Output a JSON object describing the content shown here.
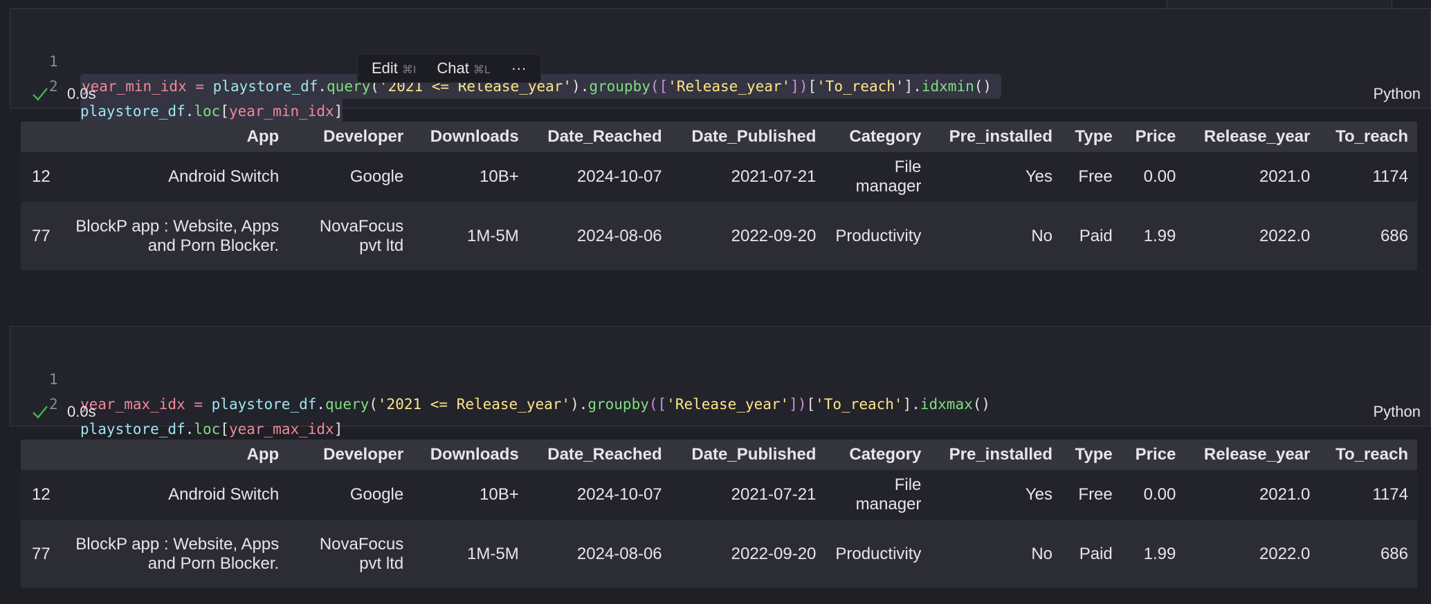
{
  "cells": [
    {
      "code": {
        "line_numbers": [
          "1",
          "2"
        ],
        "l1": {
          "var": "year_min_idx",
          "eq": " = ",
          "obj": "playstore_df",
          "dot": ".",
          "fn1": "query",
          "p1": "(",
          "s1": "'2021 <= Release_year'",
          "p2": ").",
          "fn2": "groupby",
          "b1": "([",
          "s2": "'Release_year'",
          "b2": "])",
          "p3": "[",
          "s3": "'To_reach'",
          "p4": "].",
          "fn3": "idxmin",
          "p5": "()"
        },
        "l2": {
          "obj": "playstore_df",
          "dot": ".",
          "fn": "loc",
          "o": "[",
          "var": "year_min_idx",
          "c": "]"
        }
      },
      "status": {
        "time": "0.0s",
        "language": "Python"
      }
    },
    {
      "code": {
        "line_numbers": [
          "1",
          "2"
        ],
        "l1": {
          "var": "year_max_idx",
          "eq": " = ",
          "obj": "playstore_df",
          "dot": ".",
          "fn1": "query",
          "p1": "(",
          "s1": "'2021 <= Release_year'",
          "p2": ").",
          "fn2": "groupby",
          "b1": "([",
          "s2": "'Release_year'",
          "b2": "])",
          "p3": "[",
          "s3": "'To_reach'",
          "p4": "].",
          "fn3": "idxmax",
          "p5": "()"
        },
        "l2": {
          "obj": "playstore_df",
          "dot": ".",
          "fn": "loc",
          "o": "[",
          "var": "year_max_idx",
          "c": "]"
        }
      },
      "status": {
        "time": "0.0s",
        "language": "Python"
      }
    }
  ],
  "popup": {
    "edit": "Edit",
    "edit_kbd": "⌘I",
    "chat": "Chat",
    "chat_kbd": "⌘L",
    "more": "···"
  },
  "table": {
    "columns": [
      "",
      "App",
      "Developer",
      "Downloads",
      "Date_Reached",
      "Date_Published",
      "Category",
      "Pre_installed",
      "Type",
      "Price",
      "Release_year",
      "To_reach"
    ],
    "rows": [
      [
        "12",
        "Android Switch",
        "Google",
        "10B+",
        "2024-10-07",
        "2021-07-21",
        "File manager",
        "Yes",
        "Free",
        "0.00",
        "2021.0",
        "1174"
      ],
      [
        "77",
        "BlockP app : Website, Apps and Porn Blocker.",
        "NovaFocus pvt ltd",
        "1M-5M",
        "2024-08-06",
        "2022-09-20",
        "Productivity",
        "No",
        "Paid",
        "1.99",
        "2022.0",
        "686"
      ]
    ]
  }
}
